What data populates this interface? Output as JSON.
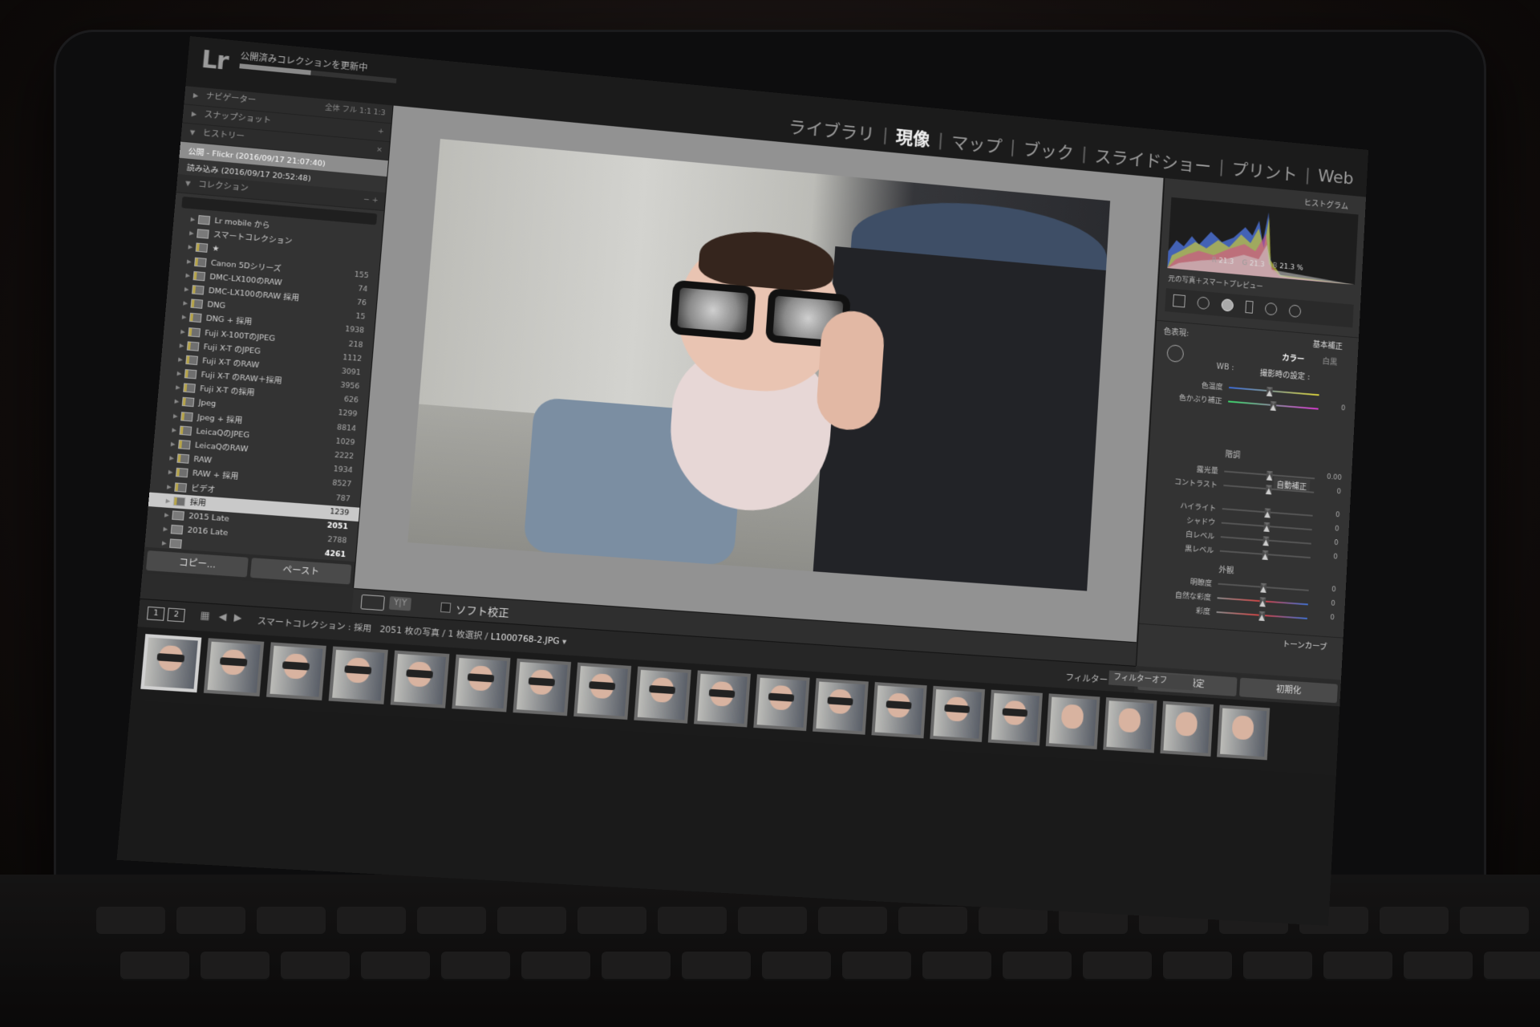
{
  "app": {
    "logo": "Lr",
    "status_text": "公開済みコレクションを更新中",
    "status_progress": 0.45
  },
  "modules": [
    {
      "label": "ライブラリ",
      "active": false
    },
    {
      "label": "現像",
      "active": true
    },
    {
      "label": "マップ",
      "active": false
    },
    {
      "label": "ブック",
      "active": false
    },
    {
      "label": "スライドショー",
      "active": false
    },
    {
      "label": "プリント",
      "active": false
    },
    {
      "label": "Web",
      "active": false
    }
  ],
  "left_panel": {
    "navigator": {
      "title": "ナビゲーター",
      "zoom_options": [
        "全体",
        "フル",
        "1:1",
        "1:3"
      ]
    },
    "snapshots": {
      "title": "スナップショット"
    },
    "history": {
      "title": "ヒストリー",
      "items": [
        {
          "label": "公開 - Flickr (2016/09/17 21:07:40)",
          "selected": true
        },
        {
          "label": "読み込み (2016/09/17 20:52:48)",
          "selected": false
        }
      ]
    },
    "collections": {
      "title": "コレクション",
      "items": [
        {
          "label": "Lr mobile から",
          "count": "",
          "smart": false
        },
        {
          "label": "スマートコレクション",
          "count": "",
          "smart": false
        },
        {
          "label": "★",
          "count": "",
          "smart": true
        },
        {
          "label": "Canon 5Dシリーズ",
          "count": "155",
          "smart": true
        },
        {
          "label": "DMC-LX100のRAW",
          "count": "74",
          "smart": true
        },
        {
          "label": "DMC-LX100のRAW 採用",
          "count": "76",
          "smart": true
        },
        {
          "label": "DNG",
          "count": "15",
          "smart": true
        },
        {
          "label": "DNG + 採用",
          "count": "1938",
          "smart": true
        },
        {
          "label": "Fuji X-100TのJPEG",
          "count": "218",
          "smart": true
        },
        {
          "label": "Fuji X-T のJPEG",
          "count": "1112",
          "smart": true
        },
        {
          "label": "Fuji X-T のRAW",
          "count": "3091",
          "smart": true
        },
        {
          "label": "Fuji X-T のRAW＋採用",
          "count": "3956",
          "smart": true
        },
        {
          "label": "Fuji X-T の採用",
          "count": "626",
          "smart": true
        },
        {
          "label": "Jpeg",
          "count": "1299",
          "smart": true
        },
        {
          "label": "Jpeg + 採用",
          "count": "8814",
          "smart": true
        },
        {
          "label": "LeicaQのJPEG",
          "count": "1029",
          "smart": true
        },
        {
          "label": "LeicaQのRAW",
          "count": "2222",
          "smart": true
        },
        {
          "label": "RAW",
          "count": "1934",
          "smart": true
        },
        {
          "label": "RAW + 採用",
          "count": "8527",
          "smart": true
        },
        {
          "label": "ビデオ",
          "count": "787",
          "smart": true
        },
        {
          "label": "採用",
          "count": "1239",
          "smart": true,
          "selected": true
        },
        {
          "label": "2015 Late",
          "count": "2051",
          "smart": false,
          "bold": true
        },
        {
          "label": "2016 Late",
          "count": "2788",
          "smart": false
        },
        {
          "label": "",
          "count": "4261",
          "smart": false,
          "bold": true
        }
      ]
    },
    "buttons": {
      "copy": "コピー...",
      "paste": "ペースト"
    }
  },
  "center": {
    "toolbar": {
      "soft_proof": "ソフト校正",
      "yy": "Y|Y"
    }
  },
  "right_panel": {
    "histogram": {
      "title": "ヒストグラム",
      "r_label": "R",
      "r": "21.3",
      "g_label": "G",
      "g": "21.3",
      "b_label": "B",
      "b": "21.3 %",
      "preview": "元の写真＋スマートプレビュー"
    },
    "basic": {
      "treatment_label": "色表現:",
      "title": "基本補正",
      "color": "カラー",
      "bw": "白黒",
      "wb_label": "WB :",
      "wb_value": "撮影時の設定 :",
      "tone_title": "階調",
      "auto": "自動補正",
      "presence_title": "外観",
      "sliders": [
        {
          "name": "色温度",
          "value": "",
          "pos": 0.45,
          "group": "wb"
        },
        {
          "name": "色かぶり補正",
          "value": "0",
          "pos": 0.5,
          "group": "wb"
        },
        {
          "name": "露光量",
          "value": "0.00",
          "pos": 0.5,
          "group": "tone"
        },
        {
          "name": "コントラスト",
          "value": "0",
          "pos": 0.5,
          "group": "tone"
        },
        {
          "name": "ハイライト",
          "value": "0",
          "pos": 0.5,
          "group": "tone2"
        },
        {
          "name": "シャドウ",
          "value": "0",
          "pos": 0.5,
          "group": "tone2"
        },
        {
          "name": "白レベル",
          "value": "0",
          "pos": 0.5,
          "group": "tone2"
        },
        {
          "name": "黒レベル",
          "value": "0",
          "pos": 0.5,
          "group": "tone2"
        },
        {
          "name": "明瞭度",
          "value": "0",
          "pos": 0.5,
          "group": "presence"
        },
        {
          "name": "自然な彩度",
          "value": "0",
          "pos": 0.5,
          "group": "presence"
        },
        {
          "name": "彩度",
          "value": "0",
          "pos": 0.5,
          "group": "presence"
        }
      ]
    },
    "tone_curve": {
      "title": "トーンカーブ"
    },
    "buttons": {
      "previous": "前の設定",
      "reset": "初期化"
    }
  },
  "filmstrip": {
    "page1": "1",
    "page2": "2",
    "source_label": "スマートコレクション : 採用",
    "count_text": "2051 枚の写真 / 1 枚選択 /",
    "filename": "L1000768-2.JPG",
    "filter_label": "フィルター :",
    "filter_value": "フィルターオフ",
    "thumbnail_count": 19
  }
}
